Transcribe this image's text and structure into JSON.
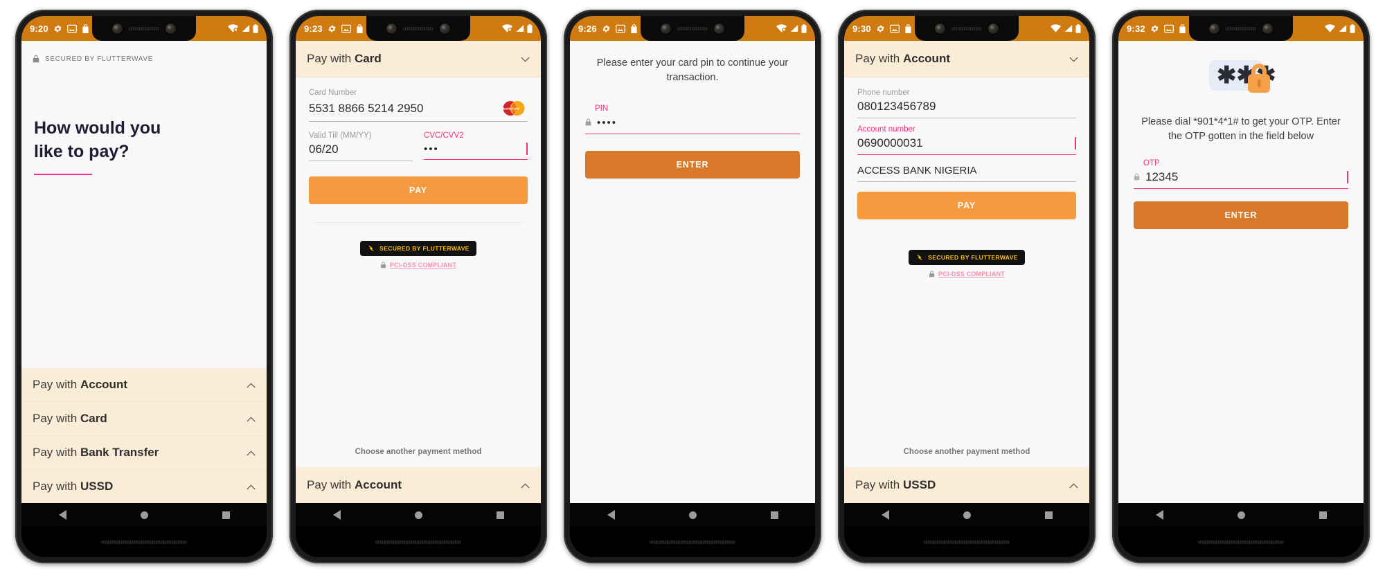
{
  "app": {
    "brand": "Flutterwave",
    "accent_orange": "#f59a3e",
    "accent_dark_orange": "#d97a2b",
    "accent_pink": "#f5317f",
    "statusbar_bg": "#cf7b12",
    "accordion_bg": "#faecd7",
    "badge_bg": "#111111",
    "badge_text_color": "#ffc107"
  },
  "common": {
    "secured_badge": "SECURED BY FLUTTERWAVE",
    "pci_label": "PCI-DSS COMPLIANT",
    "choose_another": "Choose another payment method",
    "pay_label": "PAY",
    "enter_label": "ENTER",
    "nav": {
      "back": "back-triangle",
      "home": "home-circle",
      "recent": "recent-square"
    },
    "status_icons": [
      "gear-icon",
      "photo-icon",
      "shopping-bag-icon"
    ],
    "status_right_icons": [
      "wifi-icon",
      "signal-icon",
      "battery-icon"
    ]
  },
  "screens": [
    {
      "id": "landing",
      "time": "9:20",
      "wifi": "wifi-no-internet",
      "secured_top": "SECURED BY FLUTTERWAVE",
      "headline_line1": "How would you",
      "headline_line2": "like to pay?",
      "options": [
        {
          "prefix": "Pay with ",
          "strong": "Account",
          "chevron": "chevron-up"
        },
        {
          "prefix": "Pay with ",
          "strong": "Card",
          "chevron": "chevron-up"
        },
        {
          "prefix": "Pay with ",
          "strong": "Bank Transfer",
          "chevron": "chevron-up"
        },
        {
          "prefix": "Pay with ",
          "strong": "USSD",
          "chevron": "chevron-up"
        }
      ]
    },
    {
      "id": "card-form",
      "time": "9:23",
      "wifi": "wifi-no-internet",
      "header": {
        "prefix": "Pay with ",
        "strong": "Card",
        "chevron": "chevron-down"
      },
      "fields": {
        "card_number_label": "Card Number",
        "card_number_value": "5531 8866 5214 2950",
        "card_brand": "mastercard-logo",
        "valid_till_label": "Valid Till (MM/YY)",
        "valid_till_value": "06/20",
        "cvc_label": "CVC/CVV2",
        "cvc_value": "•••"
      },
      "footer_option": {
        "prefix": "Pay with ",
        "strong": "Account",
        "chevron": "chevron-up"
      }
    },
    {
      "id": "card-pin",
      "time": "9:26",
      "wifi": "wifi-no-internet",
      "prompt": "Please enter your card pin to continue your transaction.",
      "pin_label": "PIN",
      "pin_value": "••••"
    },
    {
      "id": "account-form",
      "time": "9:30",
      "wifi": "wifi-full",
      "header": {
        "prefix": "Pay with ",
        "strong": "Account",
        "chevron": "chevron-down"
      },
      "fields": {
        "phone_label": "Phone number",
        "phone_value": "080123456789",
        "account_label": "Account number",
        "account_value": "0690000031",
        "bank_value": "ACCESS BANK NIGERIA"
      },
      "footer_option": {
        "prefix": "Pay with ",
        "strong": "USSD",
        "chevron": "chevron-up"
      }
    },
    {
      "id": "account-otp",
      "time": "9:32",
      "wifi": "wifi-full",
      "art": "asterisks-padlock",
      "prompt": "Please dial *901*4*1# to get your OTP. Enter the OTP gotten in the field below",
      "otp_label": "OTP",
      "otp_value": "12345"
    }
  ]
}
